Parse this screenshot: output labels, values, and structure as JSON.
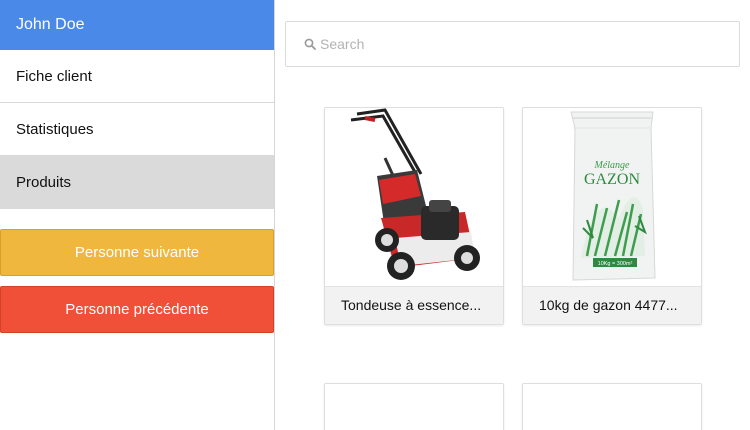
{
  "sidebar": {
    "user_name": "John Doe",
    "nav": [
      {
        "label": "Fiche client",
        "active": false
      },
      {
        "label": "Statistiques",
        "active": false
      },
      {
        "label": "Produits",
        "active": true
      }
    ],
    "next_button": "Personne suivante",
    "prev_button": "Personne précédente"
  },
  "search": {
    "placeholder": "Search",
    "value": ""
  },
  "products": [
    {
      "name": "Tondeuse à essence...",
      "image": "lawn-mower-image"
    },
    {
      "name": "10kg de gazon 4477...",
      "image": "grass-seed-bag-image",
      "bag_text_1": "Mélange",
      "bag_text_2": "GAZON",
      "bag_text_3": "10Kg = 300m²"
    },
    {
      "name": "",
      "image": ""
    },
    {
      "name": "",
      "image": ""
    }
  ],
  "colors": {
    "header": "#4a89e8",
    "next": "#f0b73e",
    "prev": "#f05038",
    "active_nav": "#dadada"
  }
}
